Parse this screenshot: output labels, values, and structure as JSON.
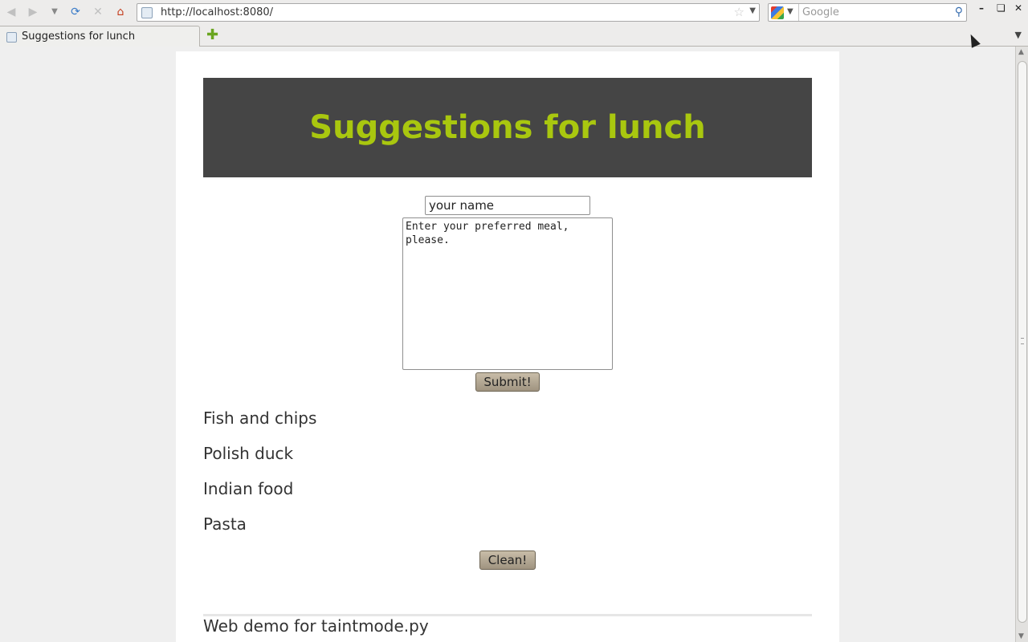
{
  "browser": {
    "url": "http://localhost:8080/",
    "search_placeholder": "Google",
    "tab_title": "Suggestions for lunch"
  },
  "page": {
    "heading": "Suggestions for lunch",
    "name_placeholder": "your name",
    "meal_placeholder": "Enter your preferred meal, please.",
    "submit_label": "Submit!",
    "clean_label": "Clean!",
    "meals": [
      "Fish and chips",
      "Polish duck",
      "Indian food",
      "Pasta"
    ],
    "footer": "Web demo for taintmode.py"
  },
  "colors": {
    "banner_bg": "#454545",
    "heading": "#a9c70f",
    "button": "#b4a994"
  },
  "icons": {
    "back": "back-arrow-icon",
    "forward": "forward-arrow-icon",
    "reload": "reload-icon",
    "stop": "stop-icon",
    "home": "home-icon",
    "bookmark": "star-icon",
    "search": "magnifier-icon",
    "new_tab": "plus-icon"
  }
}
